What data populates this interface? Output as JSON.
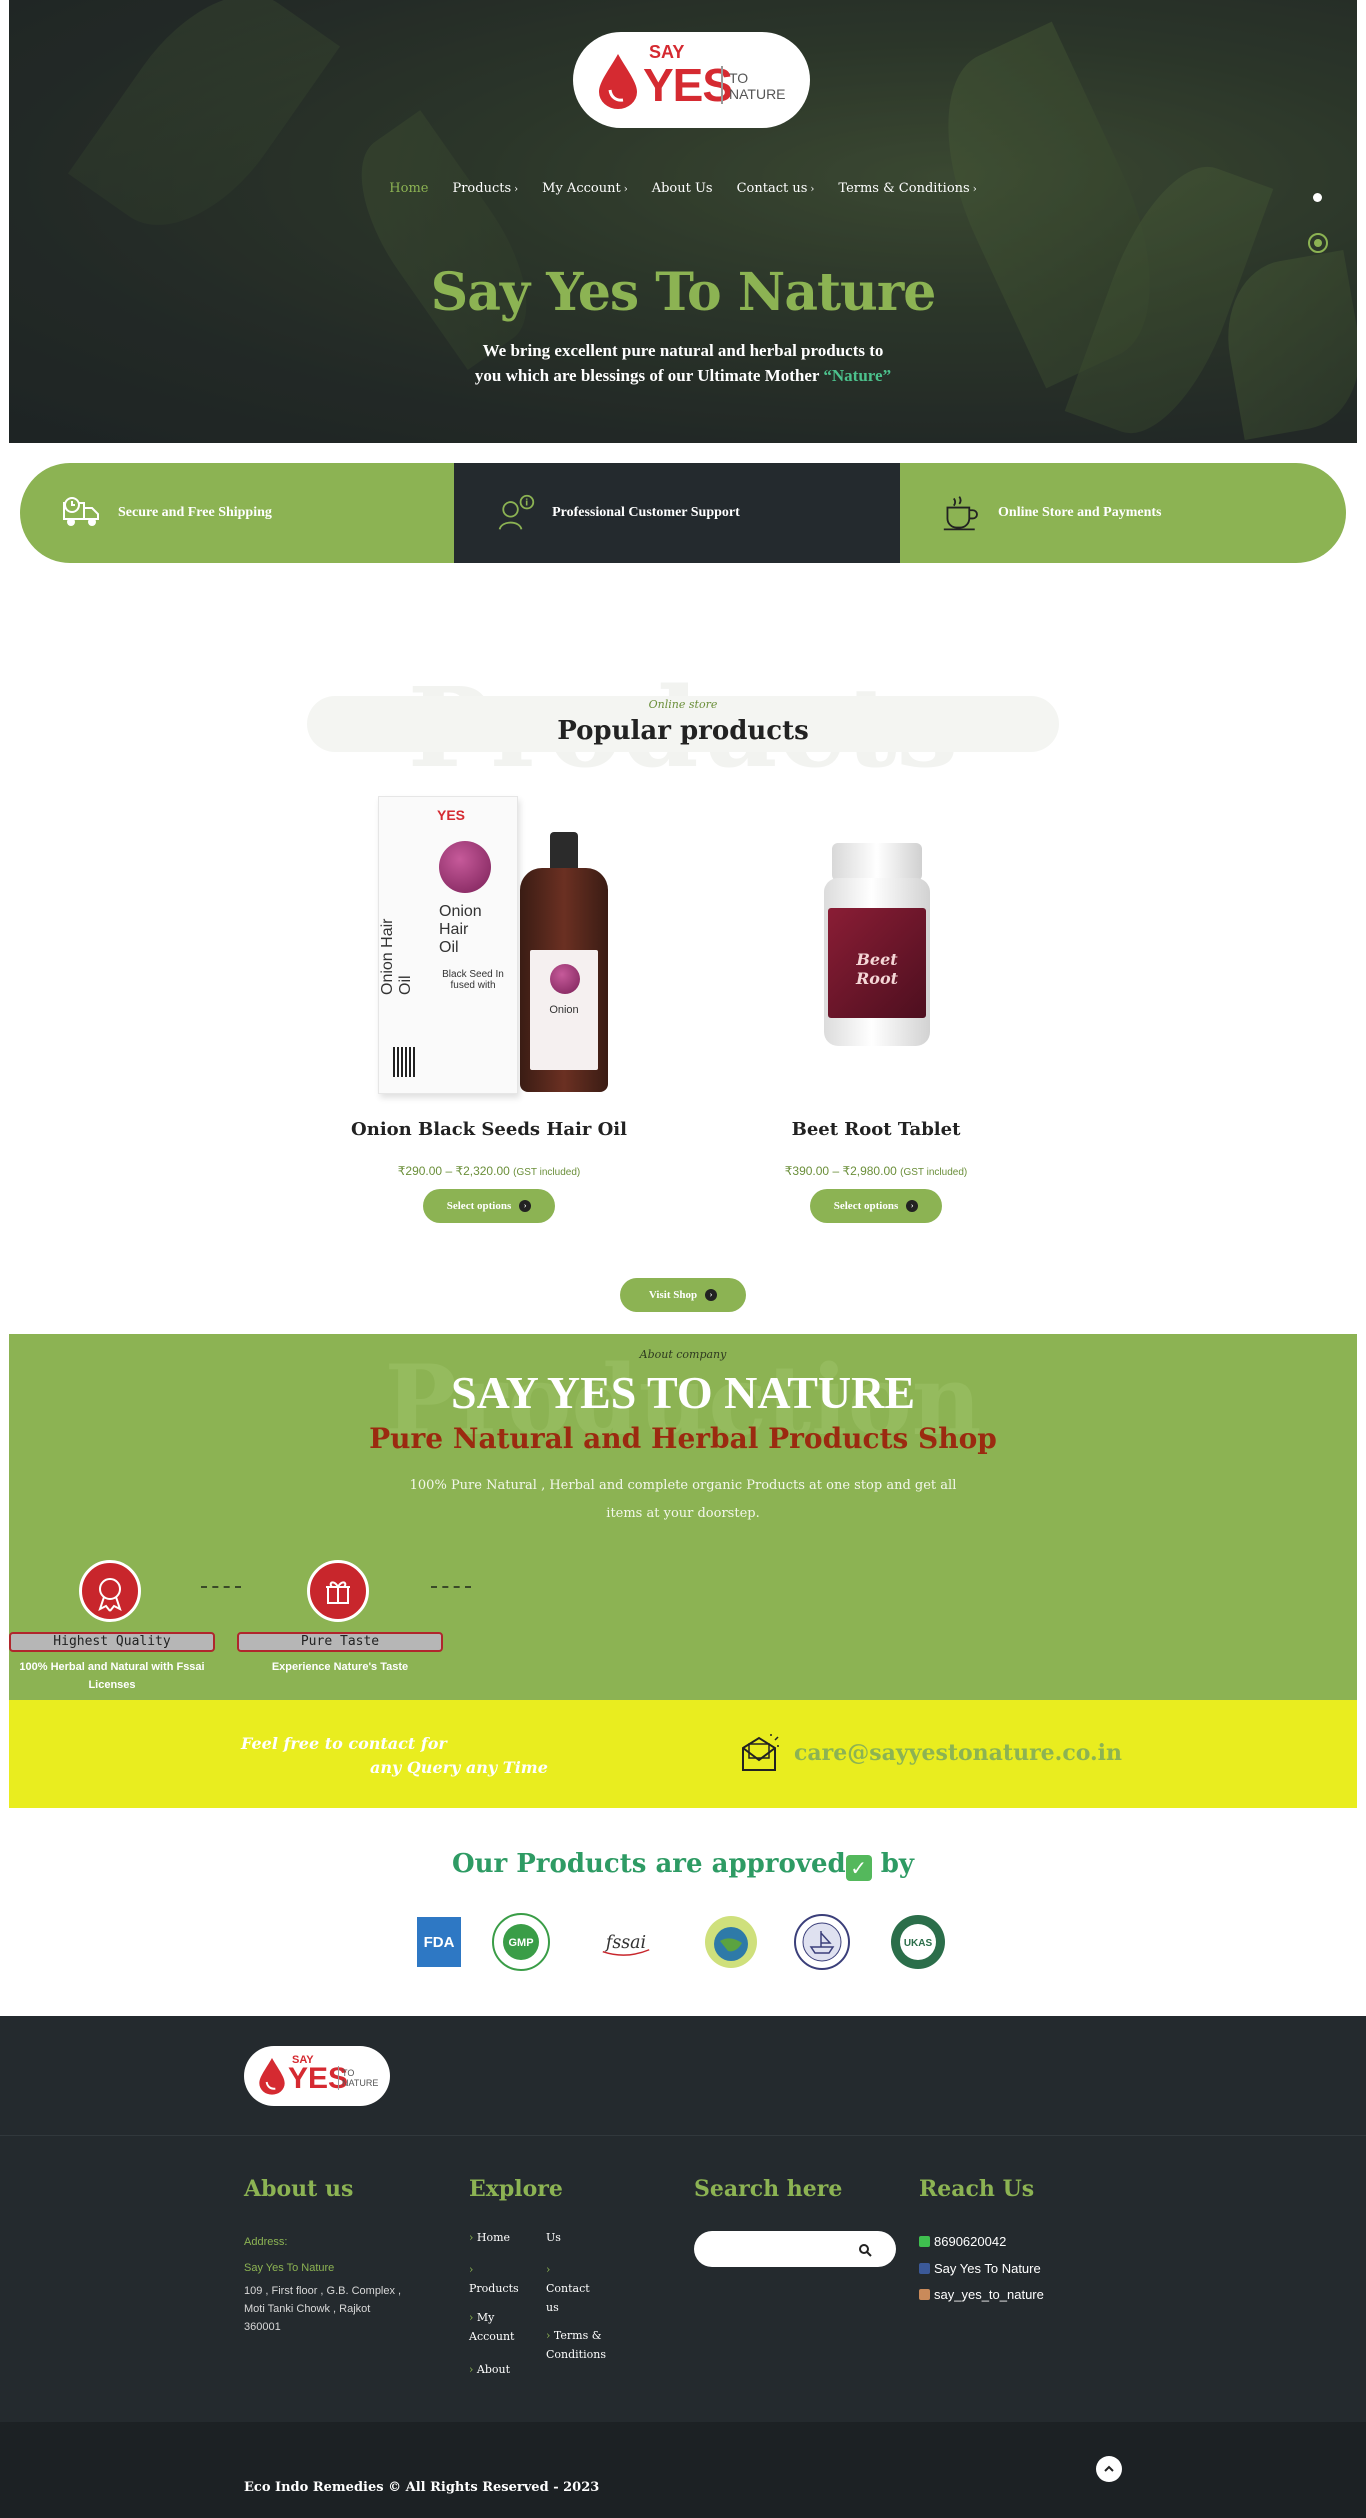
{
  "brand": {
    "logo_say": "SAY",
    "logo_yes": "YES",
    "logo_to": "TO",
    "logo_nature": "NATURE"
  },
  "nav": {
    "items": [
      {
        "label": "Home",
        "has_caret": false,
        "active": true
      },
      {
        "label": "Products",
        "has_caret": true,
        "active": false
      },
      {
        "label": "My Account",
        "has_caret": true,
        "active": false
      },
      {
        "label": "About Us",
        "has_caret": false,
        "active": false
      },
      {
        "label": "Contact us",
        "has_caret": true,
        "active": false
      },
      {
        "label": "Terms & Conditions",
        "has_caret": true,
        "active": false
      }
    ]
  },
  "hero": {
    "title": "Say Yes To Nature",
    "sub_line1": "We bring  excellent pure natural and herbal products to",
    "sub_line2_pre": "you which are blessings of our Ultimate Mother ",
    "sub_line2_highlight": "“Nature”"
  },
  "features": [
    {
      "label": "Secure and Free Shipping",
      "icon": "truck-icon"
    },
    {
      "label": "Professional Customer Support",
      "icon": "support-agent-icon"
    },
    {
      "label": "Online Store and Payments",
      "icon": "coffee-cup-icon"
    }
  ],
  "products_section": {
    "bg_word": "Products",
    "kicker": "Online store",
    "title": "Popular products",
    "items": [
      {
        "name": "Onion Black Seeds Hair Oil",
        "price": "₹290.00 – ₹2,320.00",
        "gst": "(GST included)",
        "button": "Select options",
        "image": "onion-hair-oil-image"
      },
      {
        "name": "Beet Root Tablet",
        "price": "₹390.00 – ₹2,980.00",
        "gst": "(GST included)",
        "button": "Select options",
        "image": "beet-root-tablet-image"
      }
    ],
    "visit_shop": "Visit Shop",
    "box_text": {
      "brand": "YES",
      "title1": "Onion",
      "title2": "Hair",
      "title3": "Oil",
      "line": "Black Seed In fused with",
      "side": "Onion Hair Oil"
    },
    "jar_text": "Beet Root"
  },
  "about": {
    "bg_word": "Production",
    "kicker": "About company",
    "title": "SAY YES TO NATURE",
    "subtitle": "Pure Natural and Herbal Products Shop",
    "desc": "100% Pure Natural , Herbal and complete organic Products at one stop and get all items at your doorstep.",
    "badges": [
      {
        "label": "Highest Quality",
        "desc": "100% Herbal and Natural with Fssai Licenses",
        "icon": "award-ribbon-icon"
      },
      {
        "label": "Pure Taste",
        "desc": "Experience Nature's Taste",
        "icon": "gift-box-icon"
      }
    ]
  },
  "contact_strip": {
    "line1": "Feel free to contact for",
    "line2": "any Query any Time",
    "email": "care@sayyestonature.co.in"
  },
  "approved": {
    "title": "Our Products are approved",
    "check": "✓",
    "suffix": " by",
    "certs": [
      {
        "icon": "fda-logo",
        "text": "FDA"
      },
      {
        "icon": "gmp-quality-logo",
        "text": "GMP"
      },
      {
        "icon": "fssai-logo",
        "text": "fssai"
      },
      {
        "icon": "iso-globe-logo",
        "text": ""
      },
      {
        "icon": "ship-seal-logo",
        "text": ""
      },
      {
        "icon": "ukas-logo",
        "text": "UKAS"
      }
    ]
  },
  "footer": {
    "about_title": "About us",
    "address_label": "Address:",
    "company": "Say Yes To Nature",
    "address": "109 , First floor , G.B. Complex , Moti Tanki Chowk , Rajkot 360001",
    "explore_title": "Explore",
    "explore_col1": [
      "Home",
      "Products",
      "My Account",
      "About"
    ],
    "explore_col2": [
      "Us",
      "Contact us",
      "Terms & Conditions"
    ],
    "search_title": "Search here",
    "search_placeholder": "",
    "reach_title": "Reach Us",
    "phone": "8690620042",
    "facebook": "Say Yes To Nature",
    "instagram": "say_yes_to_nature",
    "copyright": "Eco Indo Remedies © All Rights Reserved - 2023"
  },
  "colors": {
    "accent": "#8cb353",
    "dark": "#242a2e",
    "yellow": "#e9ed1f",
    "brand_red": "#d52a31"
  }
}
